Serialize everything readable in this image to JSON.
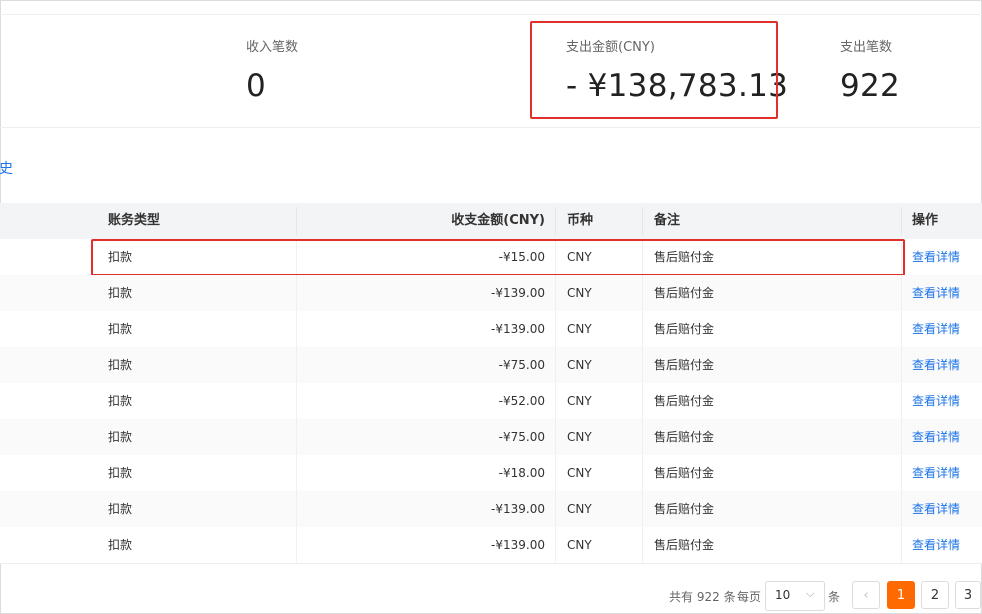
{
  "stats": {
    "income_count": {
      "label": "收入笔数",
      "value": "0"
    },
    "expense_amount": {
      "label": "支出金额(CNY)",
      "value": "- ¥138,783.13"
    },
    "expense_count": {
      "label": "支出笔数",
      "value": "922"
    }
  },
  "history_link": "史",
  "table": {
    "headers": {
      "type": "账务类型",
      "amount": "收支金额(CNY)",
      "currency": "币种",
      "remark": "备注",
      "action": "操作"
    },
    "rows": [
      {
        "type": "扣款",
        "amount": "-¥15.00",
        "currency": "CNY",
        "remark": "售后赔付金",
        "action": "查看详情"
      },
      {
        "type": "扣款",
        "amount": "-¥139.00",
        "currency": "CNY",
        "remark": "售后赔付金",
        "action": "查看详情"
      },
      {
        "type": "扣款",
        "amount": "-¥139.00",
        "currency": "CNY",
        "remark": "售后赔付金",
        "action": "查看详情"
      },
      {
        "type": "扣款",
        "amount": "-¥75.00",
        "currency": "CNY",
        "remark": "售后赔付金",
        "action": "查看详情"
      },
      {
        "type": "扣款",
        "amount": "-¥52.00",
        "currency": "CNY",
        "remark": "售后赔付金",
        "action": "查看详情"
      },
      {
        "type": "扣款",
        "amount": "-¥75.00",
        "currency": "CNY",
        "remark": "售后赔付金",
        "action": "查看详情"
      },
      {
        "type": "扣款",
        "amount": "-¥18.00",
        "currency": "CNY",
        "remark": "售后赔付金",
        "action": "查看详情"
      },
      {
        "type": "扣款",
        "amount": "-¥139.00",
        "currency": "CNY",
        "remark": "售后赔付金",
        "action": "查看详情"
      },
      {
        "type": "扣款",
        "amount": "-¥139.00",
        "currency": "CNY",
        "remark": "售后赔付金",
        "action": "查看详情"
      }
    ]
  },
  "pagination": {
    "total_prefix": "共有",
    "total": "922",
    "total_suffix": "条",
    "per_page_label": "每页",
    "per_page_value": "10",
    "per_page_suffix": "条",
    "prev_icon": "‹",
    "pages": [
      "1",
      "2",
      "3"
    ],
    "active_page": "1"
  },
  "colors": {
    "highlight": "#e0302c",
    "link": "#1a73e8",
    "active_page": "#ff6a00"
  }
}
